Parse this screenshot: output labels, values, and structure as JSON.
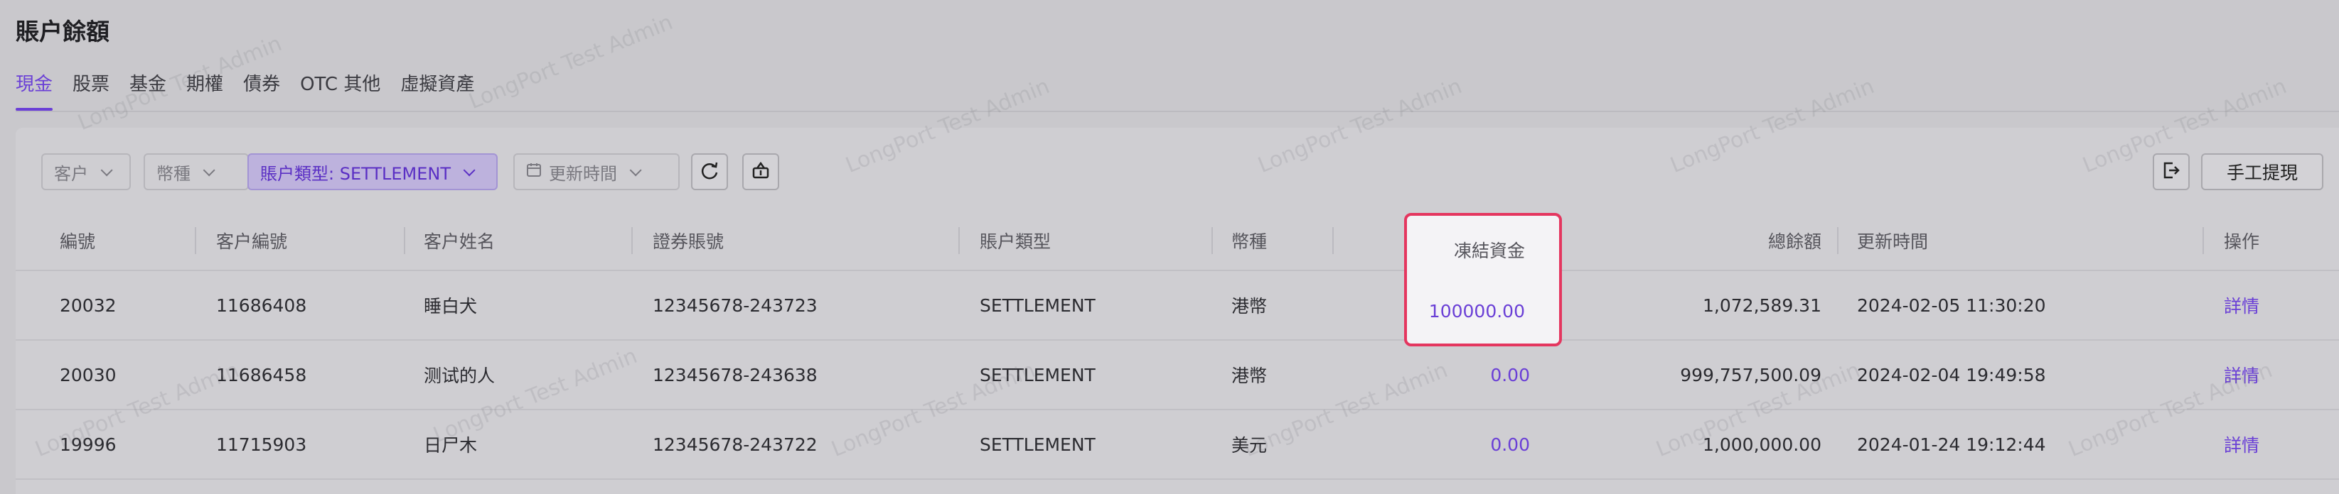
{
  "page": {
    "title": "賬户餘額"
  },
  "tabs": [
    {
      "label": "現金",
      "active": true
    },
    {
      "label": "股票",
      "active": false
    },
    {
      "label": "基金",
      "active": false
    },
    {
      "label": "期權",
      "active": false
    },
    {
      "label": "債券",
      "active": false
    },
    {
      "label": "OTC 其他",
      "active": false
    },
    {
      "label": "虛擬資產",
      "active": false
    }
  ],
  "filters": {
    "client": "客户",
    "currency": "幣種",
    "account_type": "賬户類型: SETTLEMENT",
    "update_time": "更新時間"
  },
  "toolbar": {
    "refresh_icon": "refresh-icon",
    "basket_icon": "basket-icon",
    "export_icon": "export-icon",
    "manual_withdraw_label": "手工提現"
  },
  "table": {
    "columns": {
      "id": "編號",
      "client_no": "客户編號",
      "client_name": "客户姓名",
      "securities_account": "證券賬號",
      "account_type": "賬户類型",
      "currency": "幣種",
      "frozen": "凍結資金",
      "total_balance": "總餘額",
      "updated_at": "更新時間",
      "action": "操作"
    },
    "rows": [
      {
        "id": "20032",
        "client_no": "11686408",
        "client_name": "睡白犬",
        "securities_account": "12345678-243723",
        "account_type": "SETTLEMENT",
        "currency": "港幣",
        "frozen": "100000.00",
        "total_balance": "1,072,589.31",
        "updated_at": "2024-02-05 11:30:20",
        "action": "詳情"
      },
      {
        "id": "20030",
        "client_no": "11686458",
        "client_name": "测试的人",
        "securities_account": "12345678-243638",
        "account_type": "SETTLEMENT",
        "currency": "港幣",
        "frozen": "0.00",
        "total_balance": "999,757,500.09",
        "updated_at": "2024-02-04 19:49:58",
        "action": "詳情"
      },
      {
        "id": "19996",
        "client_no": "11715903",
        "client_name": "日尸木",
        "securities_account": "12345678-243722",
        "account_type": "SETTLEMENT",
        "currency": "美元",
        "frozen": "0.00",
        "total_balance": "1,000,000.00",
        "updated_at": "2024-01-24 19:12:44",
        "action": "詳情"
      }
    ]
  },
  "watermark": {
    "text": "LongPort Test Admin"
  },
  "colors": {
    "accent": "#6a3fd6",
    "highlight": "#e4365f"
  }
}
